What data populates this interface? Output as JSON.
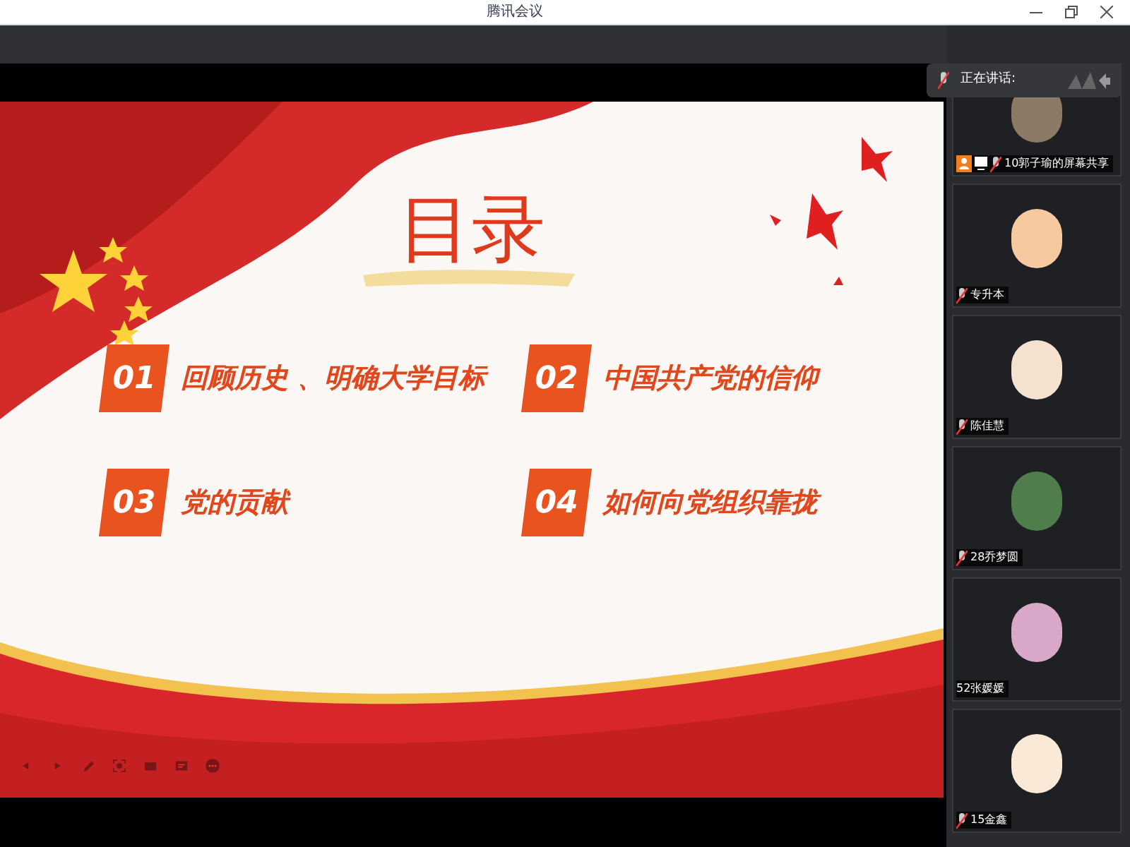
{
  "window": {
    "title": "腾讯会议"
  },
  "speaking": {
    "label": "正在讲话:"
  },
  "slide": {
    "title": "目录",
    "items": [
      {
        "number": "01",
        "text": "回顾历史 、明确大学目标"
      },
      {
        "number": "02",
        "text": "中国共产党的信仰"
      },
      {
        "number": "03",
        "text": "党的贡献"
      },
      {
        "number": "04",
        "text": "如何向党组织靠拢"
      }
    ]
  },
  "participants": [
    {
      "name": "10郭子瑜的屏幕共享",
      "kind": "screen_share",
      "muted": true
    },
    {
      "name": "专升本",
      "kind": "camera_off",
      "muted": true
    },
    {
      "name": "陈佳慧",
      "kind": "camera_off",
      "muted": true
    },
    {
      "name": "28乔梦圆",
      "kind": "camera_off",
      "muted": true
    },
    {
      "name": "52张媛媛",
      "kind": "camera_off",
      "muted": false
    },
    {
      "name": "15金鑫",
      "kind": "camera_off",
      "muted": true
    }
  ]
}
